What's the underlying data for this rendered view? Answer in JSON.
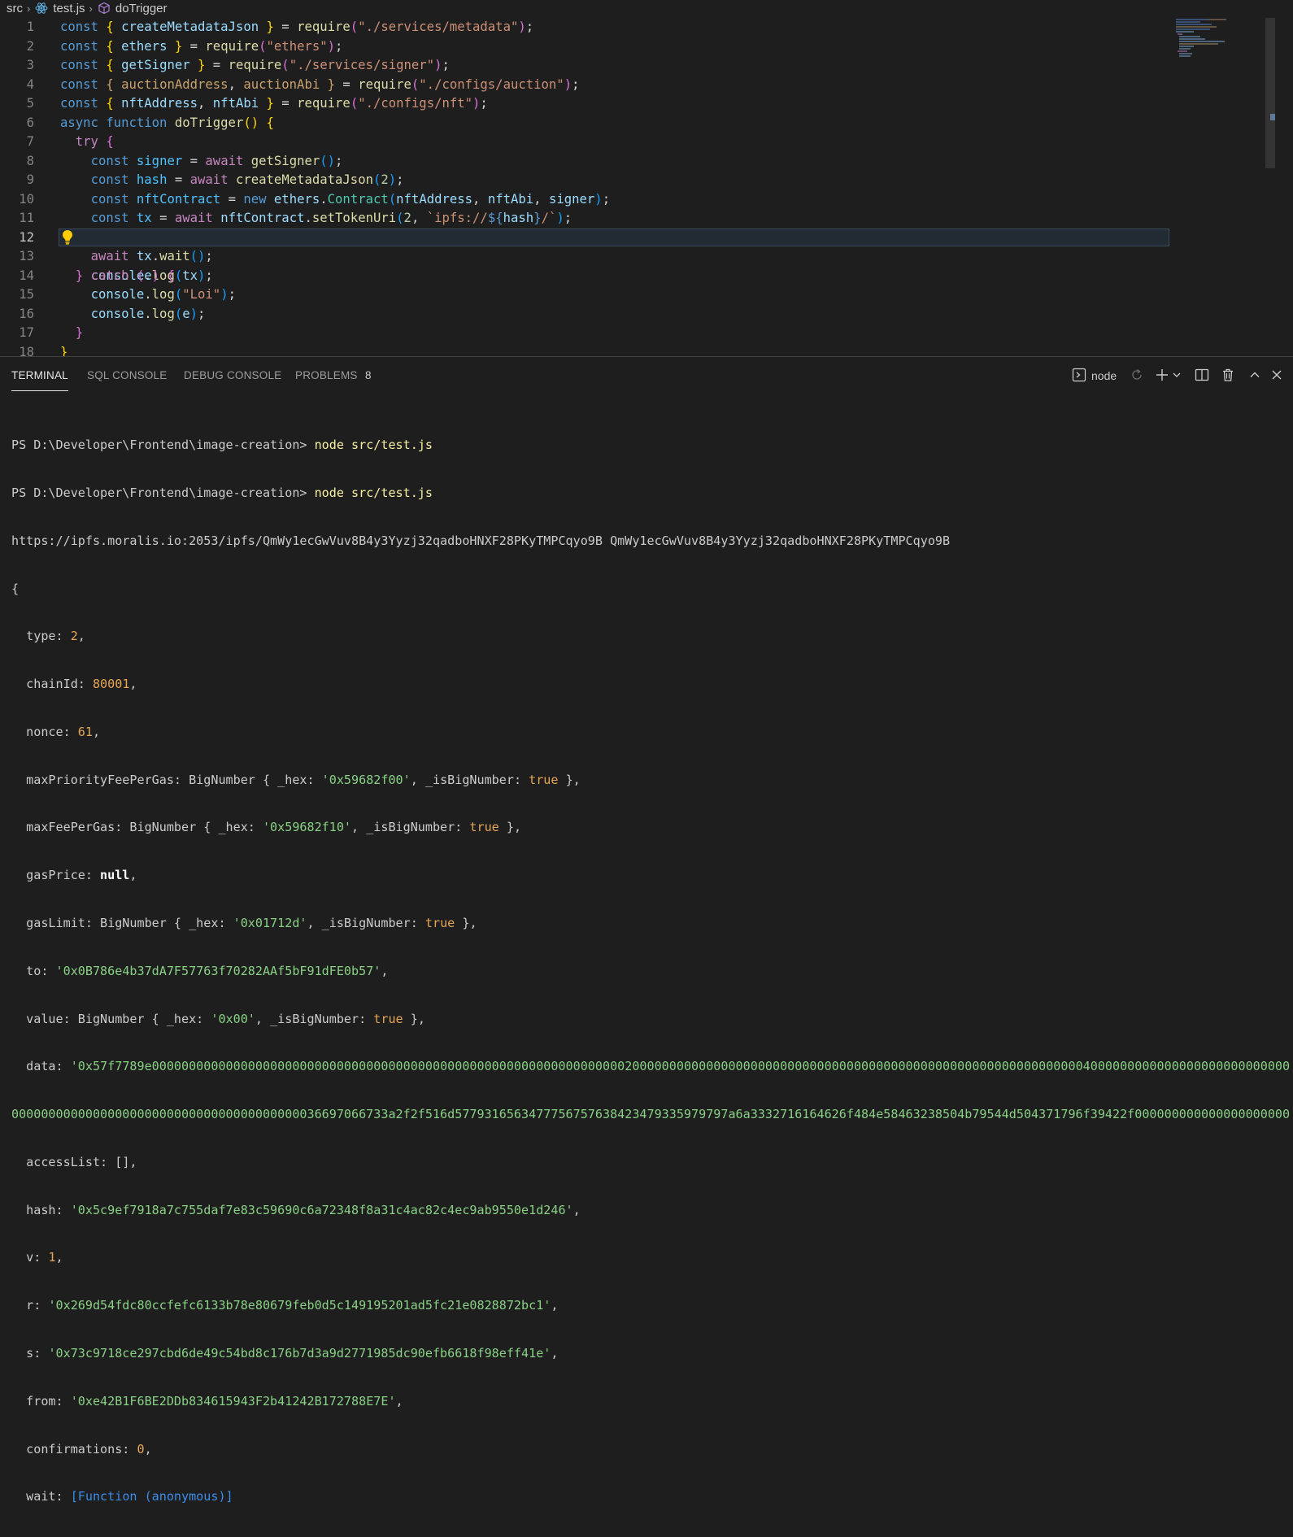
{
  "breadcrumb": {
    "folder": "src",
    "file": "test.js",
    "symbol": "doTrigger"
  },
  "editor": {
    "current_line": 12,
    "line_numbers": [
      "1",
      "2",
      "3",
      "4",
      "5",
      "6",
      "7",
      "8",
      "9",
      "10",
      "11",
      "12",
      "13",
      "14",
      "15",
      "16",
      "17",
      "18"
    ]
  },
  "panel": {
    "tabs": [
      "TERMINAL",
      "SQL CONSOLE",
      "DEBUG CONSOLE",
      "PROBLEMS"
    ],
    "problems_count": "8",
    "shell_name": "node"
  },
  "terminal": {
    "prompt1": "PS D:\\Developer\\Frontend\\image-creation> ",
    "cmd1": "node src/test.js",
    "prompt2": "PS D:\\Developer\\Frontend\\image-creation> ",
    "cmd2": "node src/test.js",
    "url_line": "https://ipfs.moralis.io:2053/ipfs/QmWy1ecGwVuv8B4y3Yyzj32qadboHNXF28PKyTMPCqyo9B QmWy1ecGwVuv8B4y3Yyzj32qadboHNXF28PKyTMPCqyo9B",
    "open_brace": "{",
    "type": "2",
    "chainId": "80001",
    "nonce": "61",
    "maxPriorityFeePerGas_hex": "'0x59682f00'",
    "maxFeePerGas_hex": "'0x59682f10'",
    "gasPrice": "null",
    "gasLimit_hex": "'0x01712d'",
    "to": "'0x0B786e4b37dA7F57763f70282AAf5bF91dFE0b57'",
    "value_hex": "'0x00'",
    "data_line1": "'0x57f7789e0000000000000000000000000000000000000000000000000000000000000000200000000000000000000000000000000000000000000000000000000000004000000000000000000000000000",
    "data_line2": "000000000000000000000000000000000000000036697066733a2f2f516d5779316563477756757638423479335979797a6a3332716164626f484e58463238504b79544d504371796f39422f000000000000000000000'",
    "accessList": "[]",
    "hash": "'0x5c9ef7918a7c755daf7e83c59690c6a72348f8a31c4ac82c4ec9ab9550e1d246'",
    "v": "1",
    "r": "'0x269d54fdc80ccfefc6133b78e80679feb0d5c149195201ad5fc21e0828872bc1'",
    "s": "'0x73c9718ce297cbd6de49c54bd8c176b7d3a9d2771985dc90efb6618f98eff41e'",
    "from": "'0xe42B1F6BE2DDb834615943F2b41242B172788E7E'",
    "confirmations": "0",
    "wait": "[Function (anonymous)]",
    "bool_true": "true"
  },
  "colors": {
    "background": "#1e1e1e",
    "keyword": "#569cd6",
    "function": "#dcdcaa",
    "string": "#ce9178",
    "terminal_string": "#89d185",
    "terminal_number": "#e5a657"
  }
}
